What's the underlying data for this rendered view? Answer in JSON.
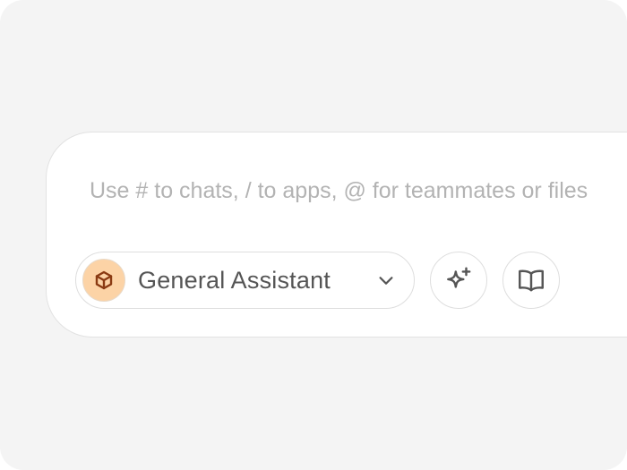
{
  "composer": {
    "placeholder": "Use # to chats, / to apps, @ for teammates or files",
    "value": ""
  },
  "toolbar": {
    "assistant_label": "General Assistant",
    "assistant_icon": "cube-icon",
    "dropdown_icon": "chevron-down-icon",
    "buttons": [
      {
        "icon": "sparkles-icon"
      },
      {
        "icon": "book-open-icon"
      }
    ]
  },
  "colors": {
    "background": "#f4f4f4",
    "composer": "#ffffff",
    "avatar_fill": "#fcd3a6",
    "avatar_icon": "#8a3a12",
    "text": "#555555",
    "placeholder": "#b3b3b3",
    "border": "#dedede"
  }
}
